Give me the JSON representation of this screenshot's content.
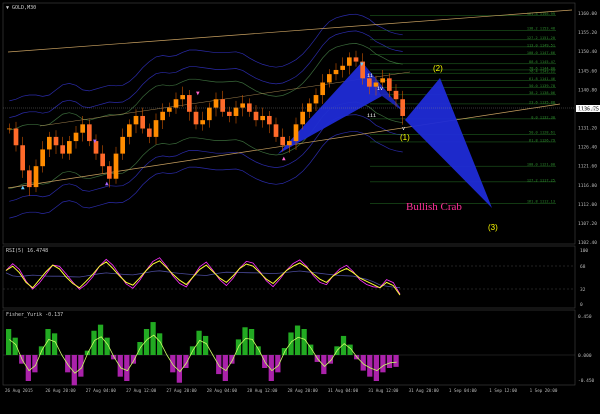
{
  "window": {
    "main_title": "▼ GOLD,M30",
    "rsi_title": "RSI(5) 16.4748",
    "fisher_title": "Fisher_Yurik -0.137"
  },
  "colors": {
    "background": "#000000",
    "bull_candle": "#ff8c00",
    "bear_candle": "#ff6a2a",
    "pattern_fill": "#1f2bd6",
    "channel": "#c8a060",
    "bands_blue": "#2a2aa8",
    "bands_green": "#3a6a3a",
    "rsi_line": "#ffff33",
    "rsi_magenta": "#ff33ff",
    "fisher_pos": "#22aa22",
    "fisher_neg": "#aa22aa",
    "label_yellow": "#ffff00",
    "label_pink": "#ff3399",
    "fib_green": "#2f8f2f"
  },
  "annotations": {
    "pattern_name": "Bullish Crab",
    "wave_1": "(1)",
    "wave_2": "(2)",
    "wave_3": "(3)",
    "roman_ii": "ii",
    "roman_iii": "iii",
    "roman_iv": "iv",
    "roman_v": "v"
  },
  "price_axis": {
    "labels": [
      "1160.00",
      "1155.20",
      "1150.40",
      "1145.60",
      "1140.80",
      "1136.00",
      "1131.20",
      "1126.40",
      "1121.60",
      "1116.80",
      "1112.00",
      "1107.20",
      "1102.40"
    ],
    "current_price": "1136.75"
  },
  "rsi_axis": {
    "labels": [
      "100",
      "68",
      "32",
      "0"
    ]
  },
  "fisher_axis": {
    "labels": [
      "0.450",
      "0.000",
      "-0.450"
    ]
  },
  "time_axis": {
    "labels": [
      "26 Aug 2015",
      "26 Aug 20:00",
      "27 Aug 04:00",
      "27 Aug 12:00",
      "27 Aug 20:00",
      "28 Aug 04:00",
      "28 Aug 12:00",
      "28 Aug 20:00",
      "31 Aug 04:00",
      "31 Aug 12:00",
      "31 Aug 20:00",
      "1 Sep 04:00",
      "1 Sep 12:00",
      "1 Sep 20:00"
    ]
  },
  "chart_data": {
    "type": "candlestick",
    "symbol": "GOLD,M30",
    "ylim": [
      1102.4,
      1160.0
    ],
    "close_approx": [
      1130,
      1126,
      1120,
      1116,
      1121,
      1125,
      1128,
      1126,
      1124,
      1127,
      1129,
      1131,
      1127,
      1124,
      1121,
      1118,
      1124,
      1128,
      1131,
      1133,
      1130,
      1128,
      1132,
      1134,
      1135,
      1137,
      1138,
      1134,
      1131,
      1132,
      1135,
      1137,
      1134,
      1133,
      1135,
      1136,
      1134,
      1132,
      1133,
      1131,
      1128,
      1126,
      1127,
      1131,
      1134,
      1136,
      1138,
      1141,
      1143,
      1144,
      1145,
      1147,
      1146,
      1142,
      1140,
      1141,
      1142,
      1139,
      1137,
      1133
    ],
    "fib_levels": [
      {
        "label": "161.8 1156.99",
        "price": 1156.99
      },
      {
        "label": "138.2 1153.48",
        "price": 1153.48
      },
      {
        "label": "127.2 1151.20",
        "price": 1151.2
      },
      {
        "label": "113.0 1149.51",
        "price": 1149.51
      },
      {
        "label": "100.0 1147.66",
        "price": 1147.66
      },
      {
        "label": "88.6 1145.47",
        "price": 1145.47
      },
      {
        "label": "78.6 1144.00",
        "price": 1144.0
      },
      {
        "label": "76.4 1143.22",
        "price": 1143.22
      },
      {
        "label": "61.8 1141.46",
        "price": 1141.46
      },
      {
        "label": "50.0 1139.78",
        "price": 1139.78
      },
      {
        "label": "38.2 1138.06",
        "price": 1138.06
      },
      {
        "label": "23.6 1135.88",
        "price": 1135.88
      },
      {
        "label": "0.0 1132.30",
        "price": 1132.3
      },
      {
        "label": "50.0 1128.61",
        "price": 1128.61
      },
      {
        "label": "61.8 1126.79",
        "price": 1126.79
      },
      {
        "label": "100.0 1121.00",
        "price": 1121.0
      },
      {
        "label": "127.2 1117.25",
        "price": 1117.25
      },
      {
        "label": "161.8 1112.13",
        "price": 1112.13
      }
    ],
    "rsi_values": [
      62,
      70,
      58,
      40,
      30,
      45,
      60,
      72,
      65,
      50,
      38,
      30,
      42,
      55,
      70,
      78,
      66,
      52,
      40,
      35,
      48,
      62,
      74,
      80,
      68,
      55,
      44,
      36,
      50,
      64,
      72,
      60,
      48,
      40,
      52,
      66,
      74,
      70,
      58,
      46,
      38,
      50,
      62,
      70,
      76,
      68,
      56,
      46,
      40,
      52,
      60,
      66,
      58,
      48,
      42,
      36,
      30,
      40,
      34,
      16.47
    ],
    "fisher_values": [
      0.3,
      0.2,
      -0.1,
      -0.3,
      -0.2,
      0.1,
      0.3,
      0.25,
      0.0,
      -0.2,
      -0.35,
      -0.25,
      0.05,
      0.28,
      0.35,
      0.2,
      -0.05,
      -0.25,
      -0.3,
      -0.1,
      0.15,
      0.3,
      0.38,
      0.25,
      0.0,
      -0.2,
      -0.32,
      -0.15,
      0.1,
      0.28,
      0.22,
      0.0,
      -0.22,
      -0.3,
      -0.1,
      0.18,
      0.32,
      0.3,
      0.1,
      -0.15,
      -0.3,
      -0.2,
      0.08,
      0.26,
      0.34,
      0.3,
      0.12,
      -0.08,
      -0.22,
      -0.1,
      0.1,
      0.22,
      0.12,
      -0.05,
      -0.18,
      -0.25,
      -0.3,
      -0.2,
      -0.15,
      -0.137
    ]
  }
}
